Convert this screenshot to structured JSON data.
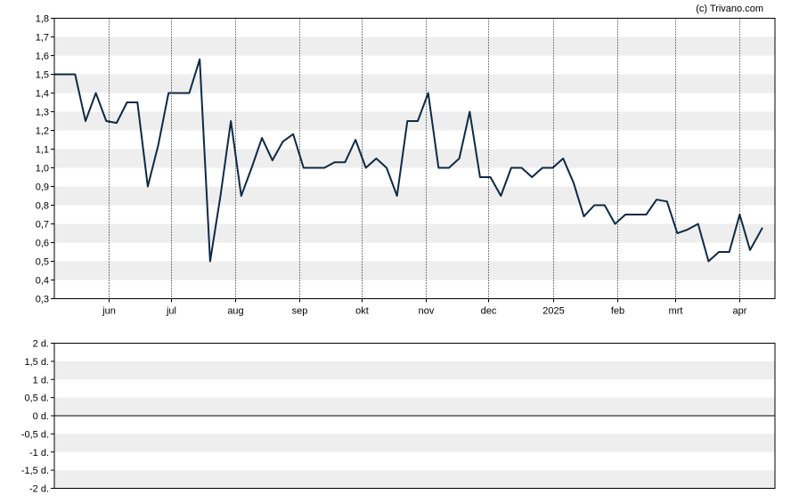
{
  "copyright": "(c) Trivano.com",
  "colors": {
    "line": "#0d2a45",
    "band": "#eeeeee",
    "frame": "#000000",
    "grid_dotted": "#000000",
    "background": "#ffffff"
  },
  "chart_data": [
    {
      "type": "line",
      "title": "",
      "xlabel": "",
      "ylabel": "",
      "ylim": [
        0.3,
        1.8
      ],
      "y_ticks": [
        "1,8",
        "1,7",
        "1,6",
        "1,5",
        "1,4",
        "1,3",
        "1,2",
        "1,1",
        "1,0",
        "0,9",
        "0,8",
        "0,7",
        "0,6",
        "0,5",
        "0,4",
        "0,3"
      ],
      "y_tick_values": [
        1.8,
        1.7,
        1.6,
        1.5,
        1.4,
        1.3,
        1.2,
        1.1,
        1.0,
        0.9,
        0.8,
        0.7,
        0.6,
        0.5,
        0.4,
        0.3
      ],
      "x_ticks": [
        {
          "label": "jun",
          "date": "2024-06-01"
        },
        {
          "label": "jul",
          "date": "2024-07-01"
        },
        {
          "label": "aug",
          "date": "2024-08-01"
        },
        {
          "label": "sep",
          "date": "2024-09-01"
        },
        {
          "label": "okt",
          "date": "2024-10-01"
        },
        {
          "label": "nov",
          "date": "2024-11-01"
        },
        {
          "label": "dec",
          "date": "2024-12-01"
        },
        {
          "label": "2025",
          "date": "2025-01-01"
        },
        {
          "label": "feb",
          "date": "2025-02-01"
        },
        {
          "label": "mrt",
          "date": "2025-03-01"
        },
        {
          "label": "apr",
          "date": "2025-04-01"
        }
      ],
      "xlim": [
        "2024-05-06",
        "2025-04-18"
      ],
      "grid": "alternating horizontal bands with dotted vertical lines at month starts",
      "series": [
        {
          "values": [
            [
              "2024-05-06",
              1.5
            ],
            [
              "2024-05-16",
              1.5
            ],
            [
              "2024-05-21",
              1.25
            ],
            [
              "2024-05-26",
              1.4
            ],
            [
              "2024-05-31",
              1.25
            ],
            [
              "2024-06-05",
              1.24
            ],
            [
              "2024-06-10",
              1.35
            ],
            [
              "2024-06-15",
              1.35
            ],
            [
              "2024-06-20",
              0.9
            ],
            [
              "2024-06-25",
              1.12
            ],
            [
              "2024-06-30",
              1.4
            ],
            [
              "2024-07-05",
              1.4
            ],
            [
              "2024-07-10",
              1.4
            ],
            [
              "2024-07-15",
              1.58
            ],
            [
              "2024-07-20",
              0.5
            ],
            [
              "2024-07-25",
              0.85
            ],
            [
              "2024-07-30",
              1.25
            ],
            [
              "2024-08-04",
              0.85
            ],
            [
              "2024-08-09",
              1.0
            ],
            [
              "2024-08-14",
              1.16
            ],
            [
              "2024-08-19",
              1.04
            ],
            [
              "2024-08-24",
              1.14
            ],
            [
              "2024-08-29",
              1.18
            ],
            [
              "2024-09-03",
              1.0
            ],
            [
              "2024-09-08",
              1.0
            ],
            [
              "2024-09-13",
              1.0
            ],
            [
              "2024-09-18",
              1.03
            ],
            [
              "2024-09-23",
              1.03
            ],
            [
              "2024-09-28",
              1.15
            ],
            [
              "2024-10-03",
              1.0
            ],
            [
              "2024-10-08",
              1.05
            ],
            [
              "2024-10-13",
              1.0
            ],
            [
              "2024-10-18",
              0.85
            ],
            [
              "2024-10-23",
              1.25
            ],
            [
              "2024-10-28",
              1.25
            ],
            [
              "2024-11-02",
              1.4
            ],
            [
              "2024-11-07",
              1.0
            ],
            [
              "2024-11-12",
              1.0
            ],
            [
              "2024-11-17",
              1.05
            ],
            [
              "2024-11-22",
              1.3
            ],
            [
              "2024-11-27",
              0.95
            ],
            [
              "2024-12-02",
              0.95
            ],
            [
              "2024-12-07",
              0.85
            ],
            [
              "2024-12-12",
              1.0
            ],
            [
              "2024-12-17",
              1.0
            ],
            [
              "2024-12-22",
              0.95
            ],
            [
              "2024-12-27",
              1.0
            ],
            [
              "2025-01-01",
              1.0
            ],
            [
              "2025-01-06",
              1.05
            ],
            [
              "2025-01-11",
              0.92
            ],
            [
              "2025-01-16",
              0.74
            ],
            [
              "2025-01-21",
              0.8
            ],
            [
              "2025-01-26",
              0.8
            ],
            [
              "2025-01-31",
              0.7
            ],
            [
              "2025-02-05",
              0.75
            ],
            [
              "2025-02-10",
              0.75
            ],
            [
              "2025-02-15",
              0.75
            ],
            [
              "2025-02-20",
              0.83
            ],
            [
              "2025-02-25",
              0.82
            ],
            [
              "2025-03-02",
              0.65
            ],
            [
              "2025-03-07",
              0.67
            ],
            [
              "2025-03-12",
              0.7
            ],
            [
              "2025-03-17",
              0.5
            ],
            [
              "2025-03-22",
              0.55
            ],
            [
              "2025-03-27",
              0.55
            ],
            [
              "2025-04-01",
              0.75
            ],
            [
              "2025-04-06",
              0.56
            ],
            [
              "2025-04-12",
              0.68
            ]
          ]
        }
      ]
    },
    {
      "type": "line",
      "title": "",
      "xlabel": "",
      "ylabel": "",
      "ylim": [
        -2,
        2
      ],
      "y_ticks": [
        "2 d.",
        "1,5 d.",
        "1 d.",
        "0,5 d.",
        "0 d.",
        "-0,5 d.",
        "-1 d.",
        "-1,5 d.",
        "-2 d."
      ],
      "y_tick_values": [
        2,
        1.5,
        1,
        0.5,
        0,
        -0.5,
        -1,
        -1.5,
        -2
      ],
      "reference_line": 0,
      "grid": "alternating horizontal bands",
      "series": []
    }
  ]
}
